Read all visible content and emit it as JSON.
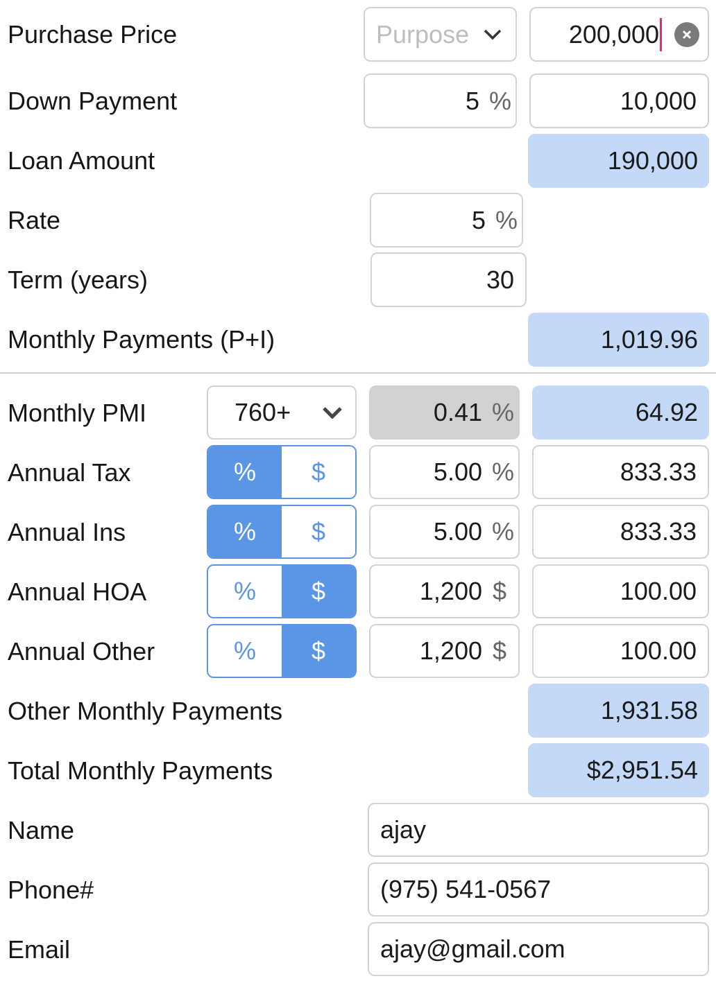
{
  "labels": {
    "purchase_price": "Purchase Price",
    "down_payment": "Down Payment",
    "loan_amount": "Loan Amount",
    "rate": "Rate",
    "term": "Term (years)",
    "monthly_pi": "Monthly Payments (P+I)",
    "monthly_pmi": "Monthly PMI",
    "annual_tax": "Annual Tax",
    "annual_ins": "Annual Ins",
    "annual_hoa": "Annual HOA",
    "annual_other": "Annual Other",
    "other_monthly": "Other Monthly Payments",
    "total_monthly": "Total Monthly Payments",
    "name": "Name",
    "phone": "Phone#",
    "email": "Email"
  },
  "purpose_select": {
    "placeholder": "Purpose"
  },
  "purchase_price_value": "200,000",
  "down_payment": {
    "percent": "5",
    "amount": "10,000"
  },
  "loan_amount": "190,000",
  "rate": {
    "value": "5",
    "unit": "%"
  },
  "term": "30",
  "monthly_pi": "1,019.96",
  "pmi": {
    "credit_tier": "760+",
    "rate": "0.41",
    "unit": "%",
    "amount": "64.92"
  },
  "tax": {
    "value": "5.00",
    "unit": "%",
    "amount": "833.33",
    "mode": "%"
  },
  "ins": {
    "value": "5.00",
    "unit": "%",
    "amount": "833.33",
    "mode": "%"
  },
  "hoa": {
    "value": "1,200",
    "unit": "$",
    "amount": "100.00",
    "mode": "$"
  },
  "other": {
    "value": "1,200",
    "unit": "$",
    "amount": "100.00",
    "mode": "$"
  },
  "toggle": {
    "percent": "%",
    "dollar": "$"
  },
  "other_monthly": "1,931.58",
  "total_monthly": "$2,951.54",
  "contact": {
    "name": "ajay",
    "phone": "(975) 541-0567",
    "email": "ajay@gmail.com"
  },
  "colors": {
    "accent": "#5b96e6",
    "computed_bg": "#c4d9f7",
    "border": "#d3d3d3",
    "caret": "#e0306a"
  },
  "icons": {
    "dropdown": "chevron-down-icon",
    "clear": "clear-icon"
  }
}
